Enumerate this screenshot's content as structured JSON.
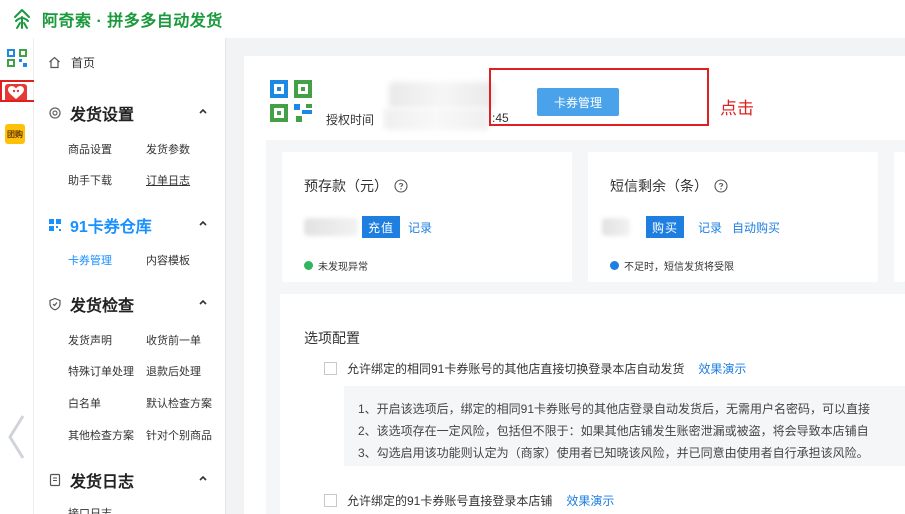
{
  "app": {
    "title": "阿奇索 · 拼多多自动发货",
    "brand_color": "#1a9a3c"
  },
  "rail": {
    "icons": [
      "qr-code-icon",
      "heart-logo-icon",
      "coupon-icon",
      "collapse-arrow-icon"
    ],
    "coupon_text": "团购"
  },
  "sidebar": {
    "home_label": "首页",
    "groups": [
      {
        "title": "发货设置",
        "items": [
          "商品设置",
          "发货参数",
          "助手下载",
          "订单日志"
        ]
      },
      {
        "title": "91卡券仓库",
        "items": [
          "卡券管理",
          "内容模板"
        ]
      },
      {
        "title": "发货检查",
        "items": [
          "发货声明",
          "收货前一单",
          "特殊订单处理",
          "退款后处理",
          "白名单",
          "默认检查方案",
          "其他检查方案",
          "针对个别商品"
        ]
      },
      {
        "title": "发货日志",
        "items": [
          "接口日志"
        ]
      }
    ]
  },
  "header": {
    "auth_label": "授权时间",
    "auth_time_suffix": ":45",
    "card_button": "卡券管理",
    "annotation": "点击"
  },
  "stats": {
    "prepaid": {
      "title": "预存款（元）",
      "primary": "充值",
      "link": "记录",
      "status": "未发现异常",
      "status_color": "#2fb55e"
    },
    "sms": {
      "title": "短信剩余（条）",
      "primary": "购买",
      "link": "记录",
      "link2": "自动购买",
      "status": "不足时，短信发货将受限",
      "status_color": "#1e7fe0"
    }
  },
  "options": {
    "title": "选项配置",
    "option1": {
      "label": "允许绑定的相同91卡券账号的其他店直接切换登录本店自动发货",
      "link": "效果演示"
    },
    "notes": [
      "1、开启该选项后，绑定的相同91卡券账号的其他店登录自动发货后，无需用户名密码，可以直接",
      "2、该选项存在一定风险，包括但不限于：如果其他店铺发生账密泄漏或被盗，将会导致本店铺自",
      "3、勾选启用该功能则认定为（商家）使用者已知晓该风险，并已同意由使用者自行承担该风险。"
    ],
    "option2": {
      "label": "允许绑定的91卡券账号直接登录本店铺",
      "link": "效果演示"
    }
  },
  "colors": {
    "primary": "#1e7fe0",
    "button": "#4aa3ea",
    "annotation": "#e02020"
  }
}
